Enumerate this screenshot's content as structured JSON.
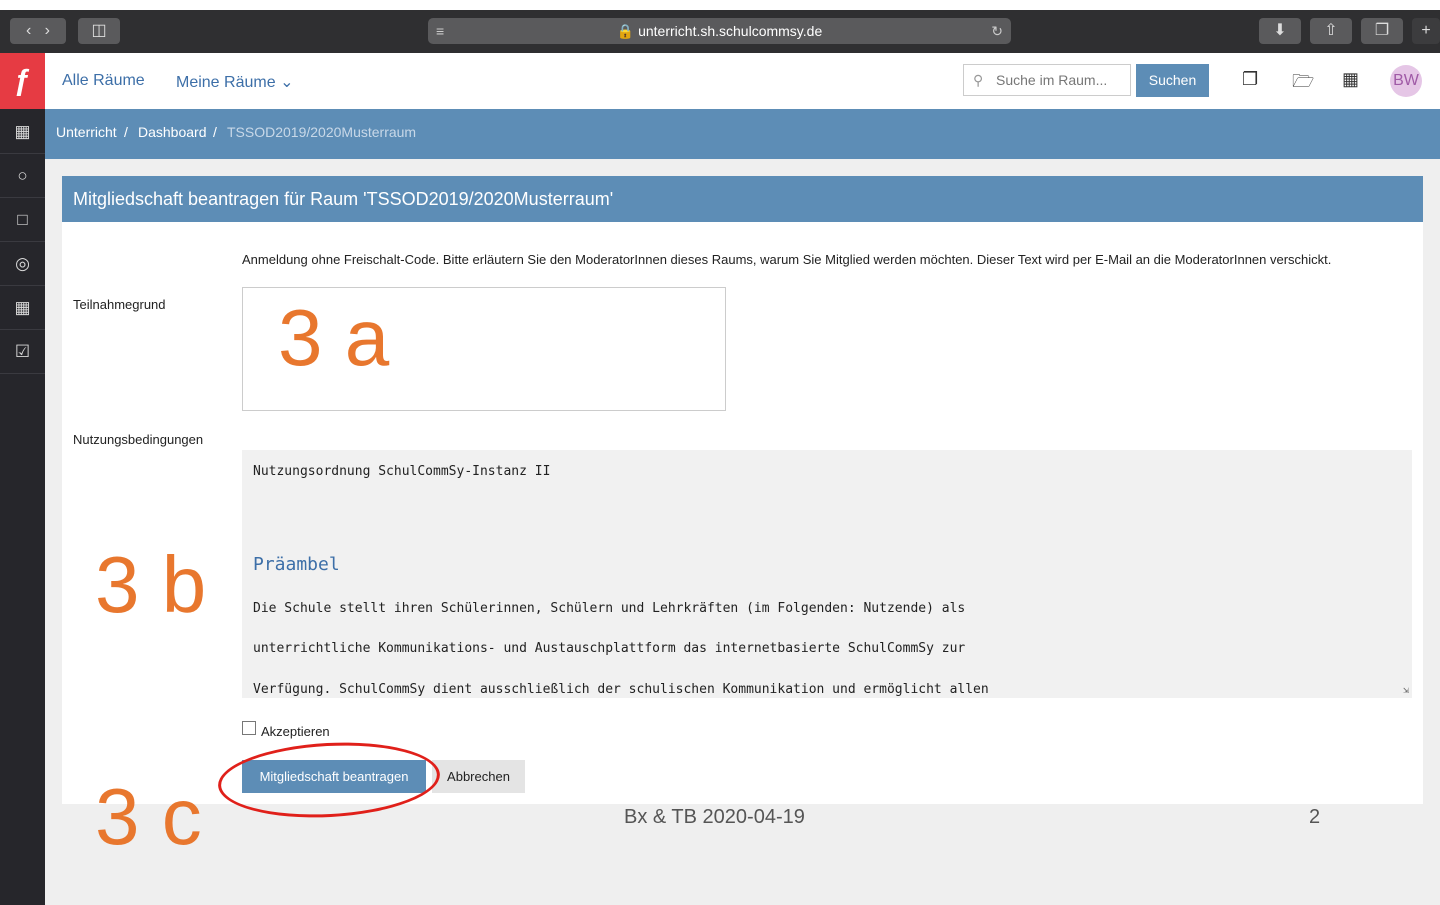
{
  "browser": {
    "url": "unterricht.sh.schulcommsy.de",
    "back_icon": "chevron-left-icon",
    "forward_icon": "chevron-right-icon"
  },
  "nav": {
    "all_rooms": "Alle Räume",
    "my_rooms": "Meine Räume",
    "search_placeholder": "Suche im Raum...",
    "search_button": "Suchen",
    "avatar_initials": "BW"
  },
  "breadcrumb": [
    "Unterricht",
    "Dashboard",
    "TSSOD2019/2020Musterraum"
  ],
  "panel": {
    "title": "Mitgliedschaft beantragen für Raum 'TSSOD2019/2020Musterraum'",
    "info": "Anmeldung ohne Freischalt-Code. Bitte erläutern Sie den ModeratorInnen dieses Raums, warum Sie Mitglied werden möchten. Dieser Text wird per E-Mail an die ModeratorInnen verschickt.",
    "reason_label": "Teilnahmegrund",
    "reason_value": "",
    "terms_label": "Nutzungsbedingungen",
    "terms_title": "Nutzungsordnung SchulCommSy-Instanz II",
    "terms_heading": "Präambel",
    "terms_lines": [
      "Die Schule stellt ihren Schülerinnen, Schülern und Lehrkräften (im Folgenden: Nutzende) als",
      "unterrichtliche Kommunikations- und Austauschplattform das internetbasierte SchulCommSy zur",
      "Verfügung. SchulCommSy dient ausschließlich der schulischen Kommunikation und ermöglicht allen"
    ],
    "accept_label": "Akzeptieren",
    "accept_checked": false,
    "submit_label": "Mitgliedschaft beantragen",
    "cancel_label": "Abbrechen"
  },
  "annotations": {
    "a": "3 a",
    "b": "3 b",
    "c": "3 c"
  },
  "footer": {
    "text": "Bx & TB 2020-04-19",
    "page": "2"
  }
}
